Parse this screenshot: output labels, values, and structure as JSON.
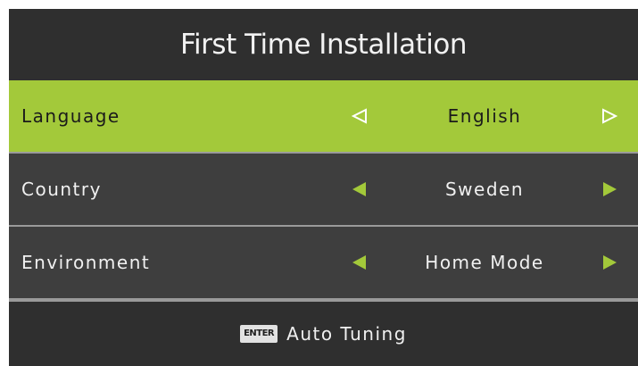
{
  "header": {
    "title": "First Time Installation"
  },
  "rows": [
    {
      "label": "Language",
      "value": "English",
      "selected": true
    },
    {
      "label": "Country",
      "value": "Sweden",
      "selected": false
    },
    {
      "label": "Environment",
      "value": "Home Mode",
      "selected": false
    }
  ],
  "icons": {
    "left_arrow": "triangle-left-icon",
    "right_arrow": "triangle-right-icon",
    "enter_key": "enter-key-icon"
  },
  "footer": {
    "key_label": "ENTER",
    "action_label": "Auto Tuning"
  },
  "colors": {
    "selected_row": "#a3c93a",
    "row_background": "#3e3e3e",
    "header_background": "#2f2f2f",
    "arrow_green": "#a3c93a",
    "arrow_outline": "#ffffff"
  }
}
